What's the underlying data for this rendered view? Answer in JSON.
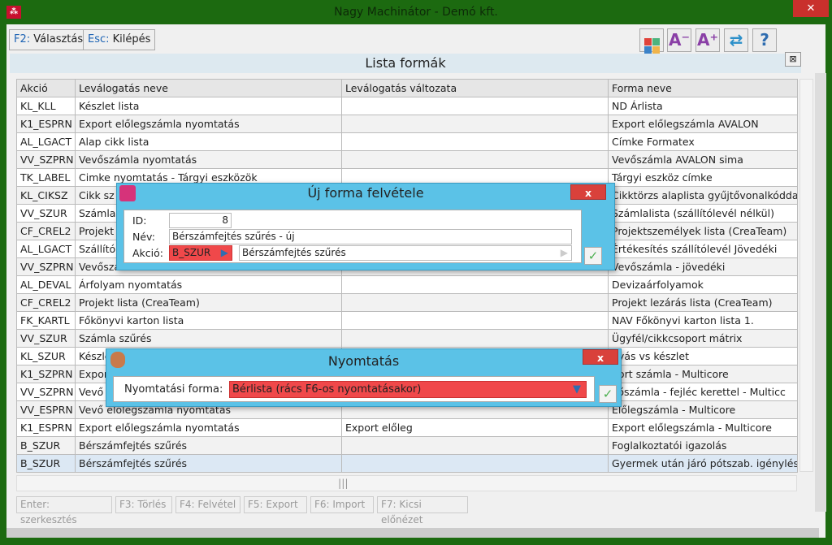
{
  "window": {
    "title": "Nagy Machinátor - Demó kft.",
    "close": "✕"
  },
  "toolbar": {
    "select_key": "F2:",
    "select_label": "Választás",
    "exit_key": "Esc:",
    "exit_label": "Kilépés",
    "help": "?"
  },
  "panel": {
    "title": "Lista formák",
    "close": "⊠"
  },
  "grid": {
    "columns": [
      "Akció",
      "Leválogatás neve",
      "Leválogatás változata",
      "Forma neve"
    ],
    "rows": [
      [
        "KL_KLL",
        "Készlet lista",
        "",
        "ND Árlista"
      ],
      [
        "K1_ESPRN",
        "Export előlegszámla nyomtatás",
        "",
        "Export előlegszámla AVALON"
      ],
      [
        "AL_LGACT",
        "Alap cikk lista",
        "",
        "Címke Formatex"
      ],
      [
        "VV_SZPRN",
        "Vevőszámla nyomtatás",
        "",
        "Vevőszámla AVALON sima"
      ],
      [
        "TK_LABEL",
        "Cimke nyomtatás - Tárgyi eszközök",
        "",
        "Tárgyi eszköz címke"
      ],
      [
        "KL_CIKSZ",
        "Cikk sz",
        "",
        "Cikktörzs alaplista gyűjtővonalkódda"
      ],
      [
        "VV_SZUR",
        "Számla",
        "",
        "Számlalista (szállítólevél nélkül)"
      ],
      [
        "CF_CREL2",
        "Projekt",
        "",
        "Projektszemélyek lista (CreaTeam)"
      ],
      [
        "AL_LGACT",
        "Szállító",
        "",
        "Értékesítés szállítólevél Jövedéki"
      ],
      [
        "VV_SZPRN",
        "Vevőszá",
        "",
        "Vevőszámla - jövedéki"
      ],
      [
        "AL_DEVAL",
        "Árfolyam nyomtatás",
        "",
        "Devizaárfolyamok"
      ],
      [
        "CF_CREL2",
        "Projekt lista (CreaTeam)",
        "",
        "Projekt lezárás lista (CreaTeam)"
      ],
      [
        "FK_KARTL",
        "Főkönyvi karton lista",
        "",
        "NAV Főkönyvi karton lista 1."
      ],
      [
        "VV_SZUR",
        "Számla szűrés",
        "",
        "Ügyfél/cikkcsoport mátrix"
      ],
      [
        "KL_SZUR",
        "Készle",
        "",
        "gyás vs készlet"
      ],
      [
        "K1_SZPRN",
        "Expor",
        "",
        "port számla - Multicore"
      ],
      [
        "VV_SZPRN",
        "Vevő",
        "",
        "vőszámla - fejléc kerettel - Multicc"
      ],
      [
        "VV_ESPRN",
        "Vevő előlegszámla nyomtatás",
        "",
        "Előlegszámla - Multicore"
      ],
      [
        "K1_ESPRN",
        "Export előlegszámla nyomtatás",
        "Export előleg",
        "Export előlegszámla - Multicore"
      ],
      [
        "B_SZUR",
        "Bérszámfejtés szűrés",
        "",
        "Foglalkoztatói igazolás"
      ],
      [
        "B_SZUR",
        "Bérszámfejtés szűrés",
        "",
        "Gyermek után járó pótszab. igénylés"
      ]
    ]
  },
  "footer_buttons": [
    "Enter: szerkesztés",
    "F3: Törlés",
    "F4: Felvétel",
    "F5: Export",
    "F6: Import",
    "F7: Kicsi előnézet"
  ],
  "new_form_dialog": {
    "title": "Új forma felvétele",
    "close": "x",
    "id_label": "ID:",
    "id_value": "8",
    "name_label": "Név:",
    "name_value": "Bérszámfejtés szűrés - új",
    "action_label": "Akció:",
    "action_code": "B_SZUR",
    "action_name": "Bérszámfejtés szűrés",
    "ok": "✓"
  },
  "print_dialog": {
    "title": "Nyomtatás",
    "close": "x",
    "form_label": "Nyomtatási forma:",
    "form_value": "Bérlista (rács F6-os nyomtatásakor)",
    "ok": "✓"
  }
}
